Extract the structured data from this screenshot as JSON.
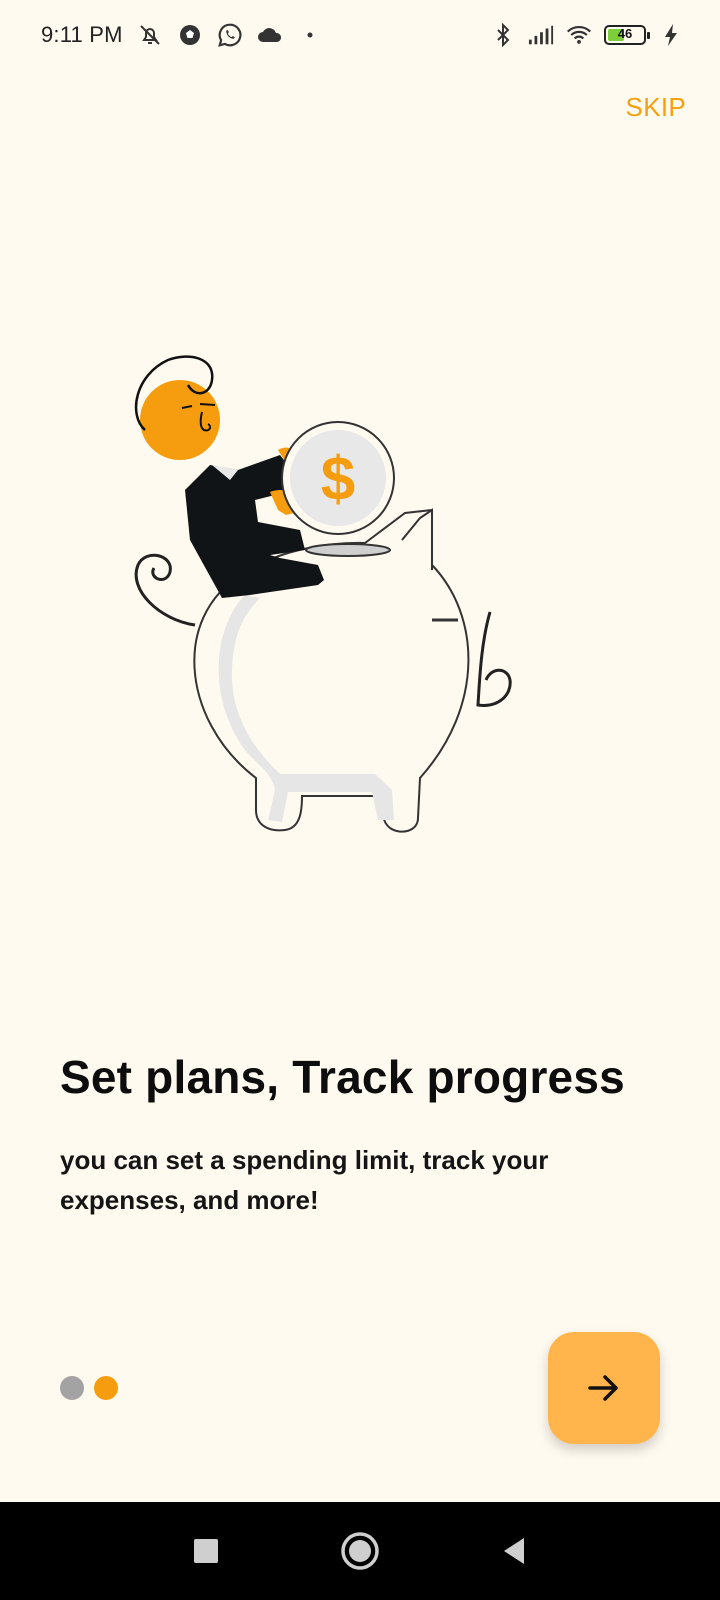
{
  "status_bar": {
    "time": "9:11 PM",
    "battery_level": "46",
    "icons_left": [
      "bell-off-icon",
      "soccer-icon",
      "whatsapp-icon",
      "cloud-icon",
      "dot-icon"
    ],
    "icons_right": [
      "bluetooth-icon",
      "signal-icon",
      "wifi-icon",
      "battery-icon",
      "charging-icon"
    ]
  },
  "header": {
    "skip_label": "SKIP"
  },
  "onboarding": {
    "title": "Set plans, Track progress",
    "subtitle": "you can set a spending limit, track your expenses, and more!",
    "illustration": "person-dropping-coin-into-piggy-bank",
    "coin_symbol": "$",
    "page_indicator": {
      "total": 2,
      "current": 2
    }
  },
  "next_button": {
    "icon": "arrow-right-icon"
  },
  "nav_bar": {
    "items": [
      "recents-button",
      "home-button",
      "back-button"
    ]
  },
  "colors": {
    "background": "#fffaf0",
    "accent": "#f59d0e",
    "button_fill": "#ffb54c",
    "dot_inactive": "#a3a3a3"
  }
}
